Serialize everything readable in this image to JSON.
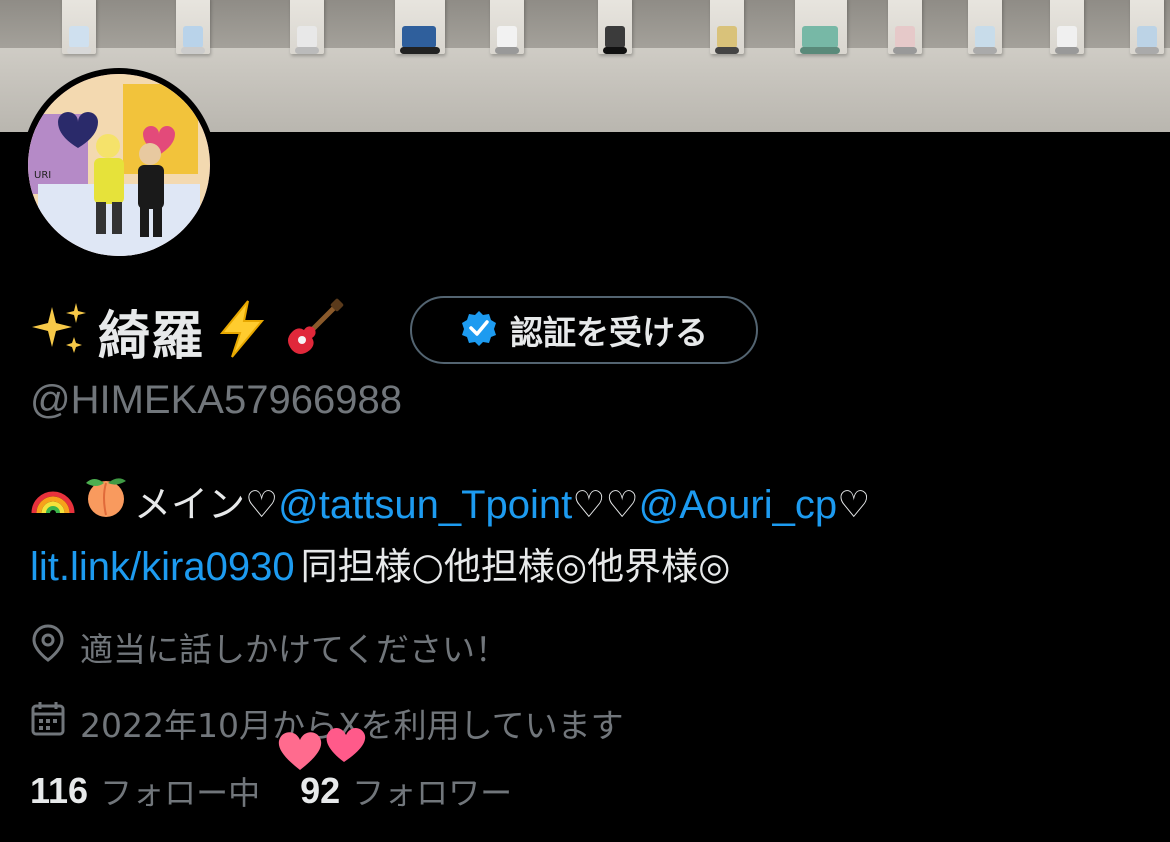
{
  "profile": {
    "display_name": "綺羅",
    "name_emoji_prefix": "sparkles-emoji",
    "name_emoji_suffix": [
      "high-voltage-emoji",
      "guitar-emoji"
    ],
    "verify_button_label": "認証を受ける",
    "handle": "@HIMEKA57966988",
    "bio": {
      "line1_emojis": [
        "rainbow-emoji",
        "peach-emoji"
      ],
      "line1_text_a": "メイン♡",
      "line1_mention_1": "@tattsun_Tpoint",
      "line1_text_b": "♡♡",
      "line1_mention_2": "@Aouri_cp",
      "line1_text_c": "♡",
      "line2_link": "lit.link/kira0930",
      "line2_text": "同担様○他担様◎他界様◎"
    },
    "location": "適当に話しかけてください！",
    "joined": "2022年10月からXを利用しています",
    "following_count": "116",
    "following_label": "フォロー中",
    "followers_count": "92",
    "followers_label": "フォロワー"
  },
  "colors": {
    "background": "#000000",
    "text_primary": "#e7e9ea",
    "text_secondary": "#71767b",
    "link": "#1d9bf0",
    "verify_badge": "#1d9bf0",
    "hearts": "#ff5a8a"
  }
}
